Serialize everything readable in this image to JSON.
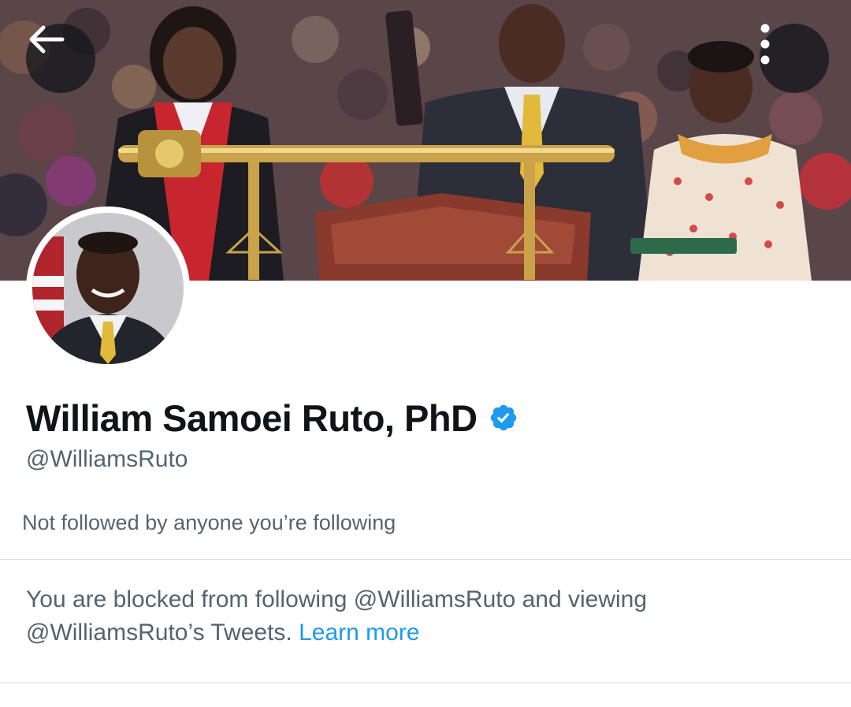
{
  "header": {
    "back_icon": "arrow-left-icon",
    "more_icon": "more-vertical-icon"
  },
  "profile": {
    "display_name": "William Samoei Ruto, PhD",
    "verified_icon": "verified-badge-icon",
    "handle": "@WilliamsRuto",
    "followed_by_text": "Not followed by anyone you’re following"
  },
  "blocked_notice": {
    "text": "You are blocked from following @WilliamsRuto and viewing @WilliamsRuto’s Tweets. ",
    "link_label": "Learn more"
  },
  "colors": {
    "primary_text": "#0f1419",
    "secondary_text": "#536471",
    "accent": "#1d9bf0",
    "divider": "#cfd9de"
  }
}
